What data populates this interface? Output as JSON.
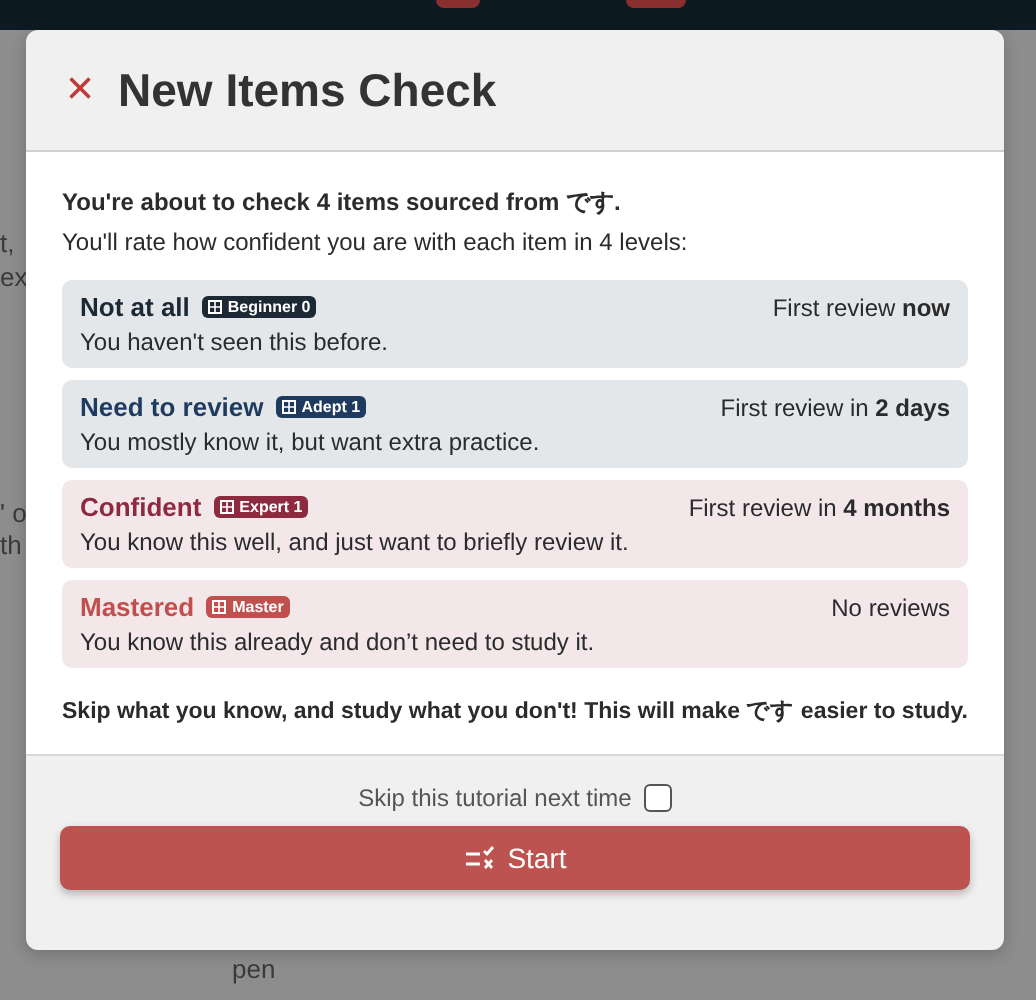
{
  "backdrop": {
    "fragments": [
      "t,",
      "ex",
      "' o",
      "th",
      "pen"
    ]
  },
  "dialog": {
    "close_icon": "×",
    "title": "New Items Check",
    "intro": "**You're about to check 4 items sourced from です.**",
    "intro_sub": "You'll rate how confident you are with each item in 4 levels:",
    "levels": [
      {
        "name": "Not at all",
        "badge": "Beginner 0",
        "color": "#1c2833",
        "kind": "neutral",
        "review": "First review **now**",
        "description": "You haven't seen this before."
      },
      {
        "name": "Need to review",
        "badge": "Adept 1",
        "color": "#1f3a5f",
        "kind": "neutral",
        "review": "First review in **2 days**",
        "description": "You mostly know it, but want extra practice."
      },
      {
        "name": "Confident",
        "badge": "Expert 1",
        "color": "#8e2a3f",
        "kind": "warm",
        "review": "First review in **4 months**",
        "description": "You know this well, and just want to briefly review it."
      },
      {
        "name": "Mastered",
        "badge": "Master",
        "color": "#c0504d",
        "kind": "warm",
        "review": "No reviews",
        "description": "You know this already and don’t need to study it."
      }
    ],
    "outro": "Skip what you know, and study what you don't! This will make です easier to study.",
    "skip_label": "Skip this tutorial next time",
    "skip_checked": false,
    "start_button": "Start"
  }
}
